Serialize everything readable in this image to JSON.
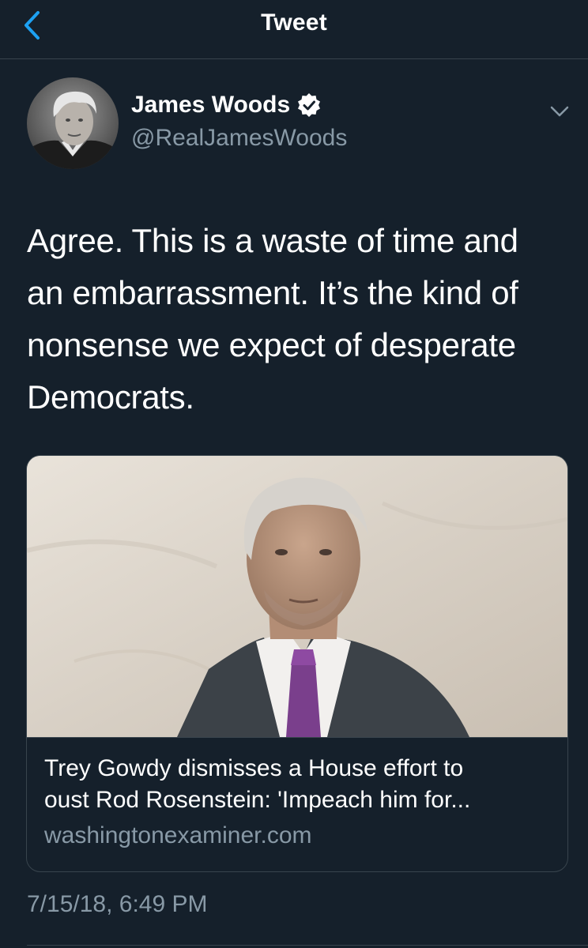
{
  "header": {
    "title": "Tweet"
  },
  "author": {
    "name": "James Woods",
    "handle": "@RealJamesWoods",
    "verified": true
  },
  "tweet": {
    "text_lines": [
      "Agree. This is a waste of time and",
      "an embarrassment. It’s the kind of",
      "nonsense we expect of desperate",
      "Democrats."
    ],
    "timestamp": "7/15/18, 6:49 PM"
  },
  "link_card": {
    "title_lines": [
      "Trey Gowdy dismisses a House effort to",
      "oust Rod Rosenstein: 'Impeach him for..."
    ],
    "domain": "washingtonexaminer.com"
  },
  "icons": {
    "back": "chevron-left-icon",
    "menu": "chevron-down-icon",
    "verified": "verified-badge-icon"
  },
  "colors": {
    "background": "#15202b",
    "accent": "#1da1f2",
    "secondary_text": "#8899a6",
    "border": "#38444d"
  }
}
